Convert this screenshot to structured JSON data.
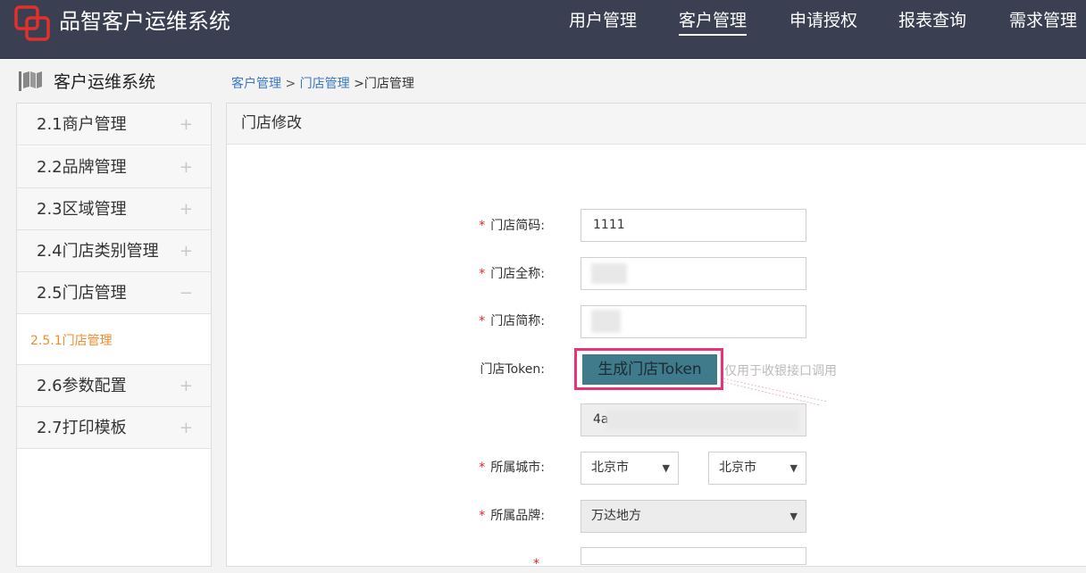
{
  "app": {
    "title": "品智客户运维系统"
  },
  "nav": [
    "用户管理",
    "客户管理",
    "申请授权",
    "报表查询",
    "需求管理"
  ],
  "sidebar": {
    "title": "客户运维系统",
    "items": [
      {
        "label": "2.1商户管理",
        "sign": "+"
      },
      {
        "label": "2.2品牌管理",
        "sign": "+"
      },
      {
        "label": "2.3区域管理",
        "sign": "+"
      },
      {
        "label": "2.4门店类别管理",
        "sign": "+"
      },
      {
        "label": "2.5门店管理",
        "sign": "−"
      },
      {
        "label": "2.6参数配置",
        "sign": "+"
      },
      {
        "label": "2.7打印模板",
        "sign": "+"
      }
    ],
    "subitem": "2.5.1门店管理"
  },
  "breadcrumb": {
    "l1": "客户管理",
    "sep1": " > ",
    "l2": "门店管理",
    "current": " >门店管理"
  },
  "panel": {
    "title": "门店修改"
  },
  "form": {
    "code_label": "门店简码:",
    "code_value": "1111",
    "fullname_label": "门店全称:",
    "shortname_label": "门店简称:",
    "token_label": "门店Token:",
    "token_button": "生成门店Token",
    "token_hint": "仅用于收银接口调用",
    "token_value": "4a",
    "city_label": "所属城市:",
    "province": "北京市",
    "city": "北京市",
    "brand_label": "所属品牌:",
    "brand": "万达地方"
  },
  "required_mark": "*",
  "colors": {
    "topbar": "#3a3f51",
    "accent": "#f08c2c",
    "link": "#3a78c3",
    "required": "#e02424",
    "highlight": "#e8337a",
    "button": "#3f7b8b"
  }
}
